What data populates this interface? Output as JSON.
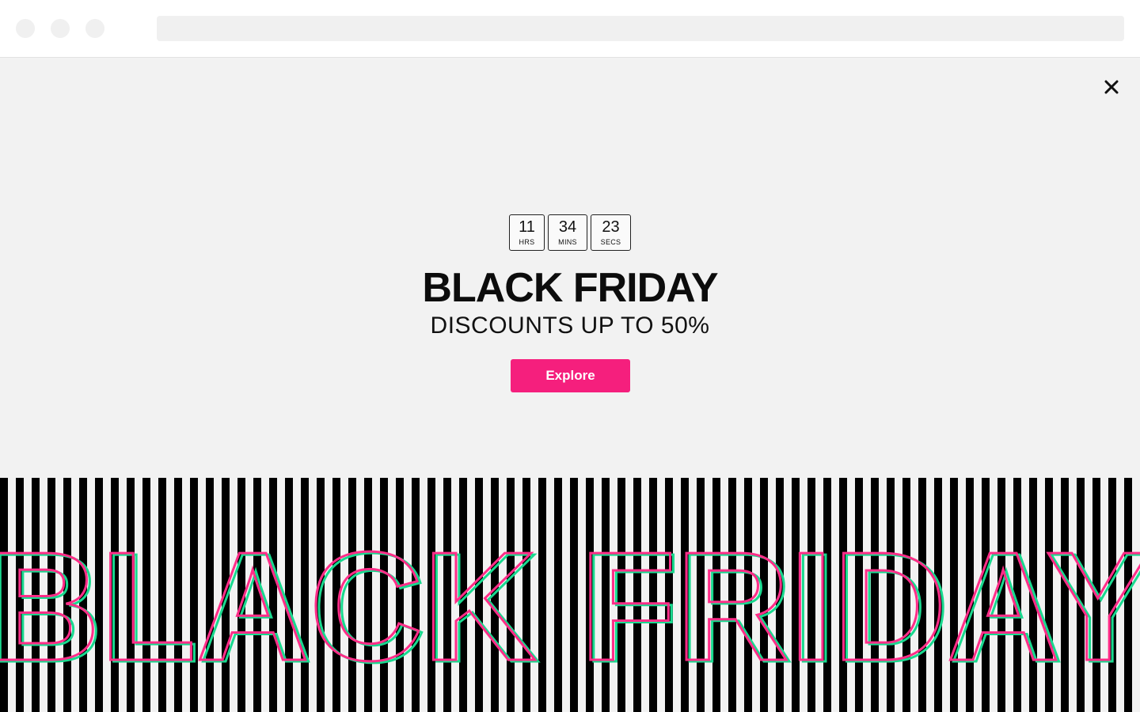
{
  "browser": {
    "window_controls": [
      "close-dot",
      "minimize-dot",
      "maximize-dot"
    ],
    "address_bar": ""
  },
  "close_icon": "close-icon",
  "countdown": [
    {
      "value": "11",
      "unit": "HRS"
    },
    {
      "value": "34",
      "unit": "MINS"
    },
    {
      "value": "23",
      "unit": "SECS"
    }
  ],
  "headline": "BLACK FRIDAY",
  "subheadline": "DISCOUNTS UP TO 50%",
  "cta_label": "Explore",
  "banner_text": "BLACK FRIDAY",
  "colors": {
    "accent": "#f51f7d",
    "outline_pink": "#ff2d88",
    "outline_green": "#19d98f",
    "stripe": "#000000",
    "background": "#f2f2f2"
  }
}
